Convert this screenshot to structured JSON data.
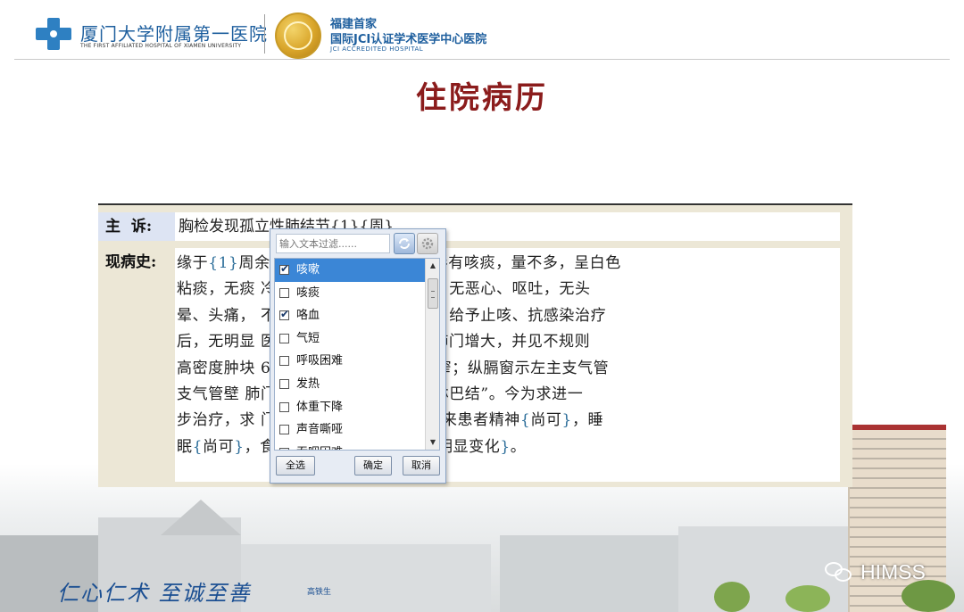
{
  "header": {
    "hospital_name": "厦门大学附属第一医院",
    "hospital_english": "THE FIRST AFFILIATED HOSPITAL OF XIAMEN UNIVERSITY",
    "jci_line1": "福建首家",
    "jci_line2": "国际JCI认证学术医学中心医院",
    "jci_line3": "JCI ACCREDITED HOSPITAL"
  },
  "title": "住院病历",
  "record": {
    "complaint_label": "主  诉:",
    "complaint_value": "胸检发现孤立性肺结节{1}{周}",
    "history_label": "现病史:",
    "history_lines": [
      [
        [
          "缘于"
        ],
        [
          "{1}",
          "tag"
        ],
        [
          "周"
        ],
        [
          "余"
        ],
        [
          "                      咳嗽，呈阵发性咳嗽，伴有咳痰，量不多，呈白色"
        ]
      ],
      [
        [
          "粘痰，无痰                          冷、发热，无气促、发绀，无恶心、呕吐，无头"
        ]
      ],
      [
        [
          "晕、头痛，                           不适，反复就诊当地医院，给予止咳、抗感染治疗"
        ]
      ],
      [
        [
          "后，无明显                           医院，行胸部CT示：“左肺门增大，并见不规则"
        ]
      ],
      [
        [
          "高密度肿块                           6cm，左主支气管管腔狭窄；纵膈窗示左主支气管"
        ]
      ],
      [
        [
          "支气管壁                             肺门及纵膈内可见多个肿大淋巴结”。今为求进一"
        ]
      ],
      [
        [
          "步治疗，求                           门占位”收住入院。发病以来患者精神"
        ],
        [
          "{",
          "tag"
        ],
        [
          "尚可"
        ],
        [
          "}",
          "tag"
        ],
        [
          "，睡"
        ]
      ],
      [
        [
          "眠"
        ],
        [
          "{",
          "tag"
        ],
        [
          "尚可"
        ],
        [
          "}",
          "tag"
        ],
        [
          "，食                           小便"
        ],
        [
          "{",
          "tag"
        ],
        [
          "正常"
        ],
        [
          "}",
          "tag"
        ],
        [
          "，"
        ],
        [
          "{",
          "tag"
        ],
        [
          "体重无明显变化"
        ],
        [
          "}",
          "tag"
        ],
        [
          "。"
        ]
      ]
    ]
  },
  "filter_popup": {
    "placeholder": "输入文本过滤......",
    "items": [
      {
        "label": "咳嗽",
        "checked": true,
        "selected": true
      },
      {
        "label": "咳痰",
        "checked": false,
        "selected": false
      },
      {
        "label": "咯血",
        "checked": true,
        "selected": false
      },
      {
        "label": "气短",
        "checked": false,
        "selected": false
      },
      {
        "label": "呼吸困难",
        "checked": false,
        "selected": false
      },
      {
        "label": "发热",
        "checked": false,
        "selected": false
      },
      {
        "label": "体重下降",
        "checked": false,
        "selected": false
      },
      {
        "label": "声音嘶哑",
        "checked": false,
        "selected": false
      },
      {
        "label": "吞咽困难",
        "checked": false,
        "selected": false
      }
    ],
    "select_all": "全选",
    "confirm": "确定",
    "cancel": "取消"
  },
  "footer": {
    "calligraphy": "仁心仁术  至诚至善",
    "signature": "高铁生",
    "watermark": "HIMSS"
  },
  "colors": {
    "title": "#8b1c1c",
    "brand_blue": "#1e5f9e",
    "selection": "#3b86d6",
    "label_bg": "#dde4f3",
    "panel_bg": "#ece7d6"
  },
  "icons": {
    "logo": "medical-cross-icon",
    "seal": "jci-seal-icon",
    "filter_left": "refresh-icon",
    "filter_right": "settings-icon",
    "watermark": "wechat-icon"
  }
}
